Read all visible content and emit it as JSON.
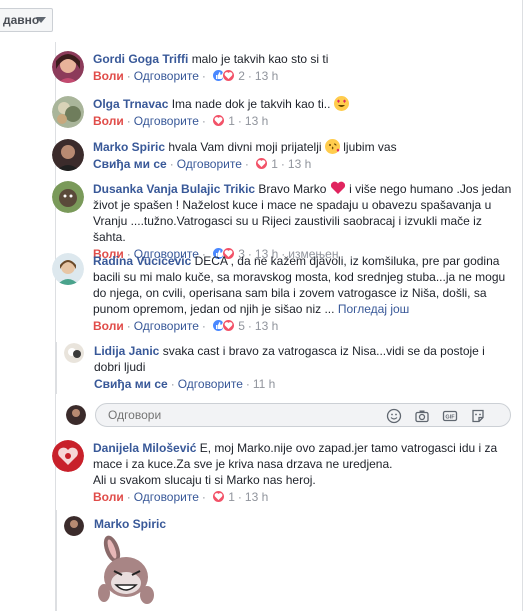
{
  "sort": {
    "label": "давно"
  },
  "actions": {
    "like": "Воли",
    "like_alt": "Свиђа ми се",
    "reply": "Одговорите",
    "see_more": "Погледај још",
    "edited": "измењен"
  },
  "comments": [
    {
      "name": "Gordi Goga Triffi",
      "text": "malo je takvih kao sto si ti",
      "reactions": [
        "like",
        "love"
      ],
      "count": "2",
      "time": "13 h"
    },
    {
      "name": "Olga Trnavac",
      "text": "Ima nade dok je takvih kao ti..",
      "reactions": [
        "love"
      ],
      "count": "1",
      "time": "13 h"
    },
    {
      "name": "Marko Spiric",
      "text": "hvala Vam divni moji prijatelji",
      "text2": "ljubim vas",
      "reactions": [
        "love"
      ],
      "count": "1",
      "time": "13 h"
    },
    {
      "name": "Dusanka Vanja Bulajic Trikic",
      "text": "Bravo Marko",
      "text2": "i više nego humano .Jos jedan život je spašen ! Naželost kuce i mace ne spadaju u obavezu spašavanja u Vranju ....tužno.Vatrogasci su u Rijeci zaustivili saobracaj i izvukli mače iz šahta.",
      "reactions": [
        "like",
        "love"
      ],
      "count": "3",
      "time": "13 h"
    },
    {
      "name": "Radina Vucicevic",
      "text": "DECA , da ne kažem djavoli, iz komšiluka, pre par godina bacili su mi malo kuče, sa moravskog mosta, kod srednjeg stuba...ja ne mogu do njega, on cvili, operisana sam bila i zovem vatrogasce iz Niša, došli, sa punom opremom, jedan od njih je sišao niz ...",
      "reactions": [
        "like",
        "love"
      ],
      "count": "5",
      "time": "13 h"
    },
    {
      "name": "Lidija Janic",
      "text": "svaka cast i bravo za vatrogasca iz Nisa...vidi se da postoje i dobri ljudi",
      "time": "11 h"
    },
    {
      "name": "Danijela Milošević",
      "text": "E, moj Marko.nije ovo zapad.jer tamo vatrogasci idu i za mace i za kuce.Za sve je kriva nasa drzava ne uredjena.",
      "text2": "Ali u svakom slucaju ti si Marko nas heroj.",
      "reactions": [
        "love"
      ],
      "count": "1",
      "time": "13 h"
    },
    {
      "name": "Marko Spiric"
    }
  ],
  "reply_box": {
    "placeholder": "Одговори"
  },
  "colors": {
    "link": "#385898",
    "like_active": "#e04c49",
    "meta": "#90949c"
  }
}
